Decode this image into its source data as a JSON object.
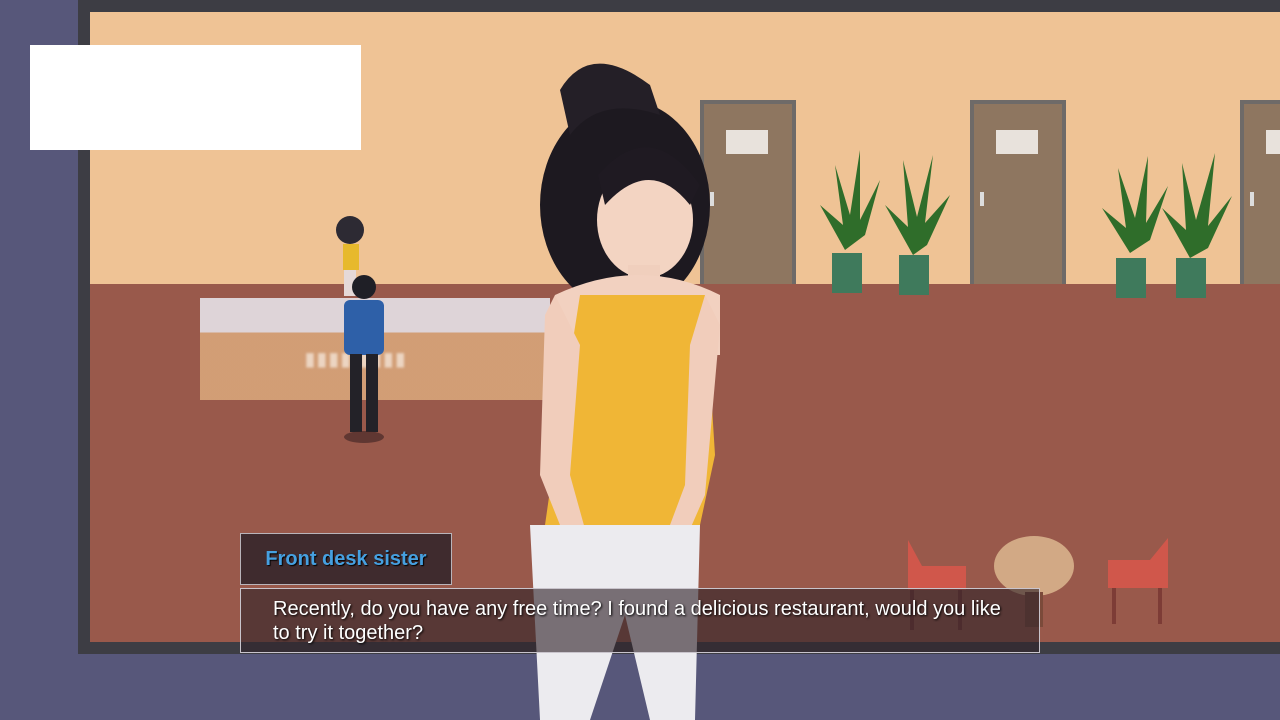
{
  "dialogue": {
    "speaker": "Front desk sister",
    "text": "Recently, do you have any free time? I found a delicious restaurant, would you like to try it together?"
  },
  "scene": {
    "background": "hotel-lobby-hallway",
    "character": "front-desk-sister-portrait"
  },
  "colors": {
    "name_text": "#46a0e0",
    "dialogue_text": "#ffffff",
    "wall": "#efc395",
    "floor": "#99594b",
    "outer": "#57577a"
  }
}
